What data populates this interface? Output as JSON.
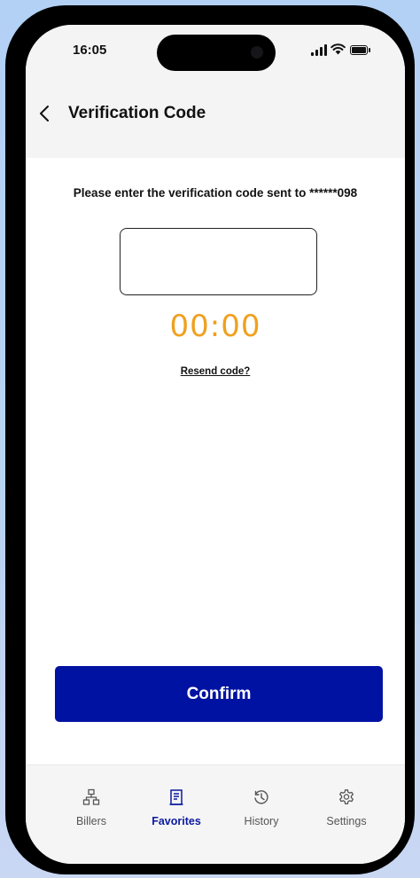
{
  "status_bar": {
    "time": "16:05"
  },
  "header": {
    "title": "Verification Code",
    "back_icon": "chevron-left-icon"
  },
  "verification": {
    "prompt": "Please enter the verification code sent to ******098",
    "code_value": "",
    "timer": "00:00",
    "resend_label": "Resend code?"
  },
  "actions": {
    "confirm_label": "Confirm"
  },
  "tabbar": {
    "active_tab": "Favorites",
    "tabs": [
      {
        "label": "Billers",
        "icon": "sitemap-icon"
      },
      {
        "label": "Favorites",
        "icon": "receipt-icon"
      },
      {
        "label": "History",
        "icon": "history-icon"
      },
      {
        "label": "Settings",
        "icon": "gear-icon"
      }
    ]
  },
  "colors": {
    "primary": "#0012a2",
    "timer": "#f0a01e",
    "background": "#b3d0f5"
  }
}
